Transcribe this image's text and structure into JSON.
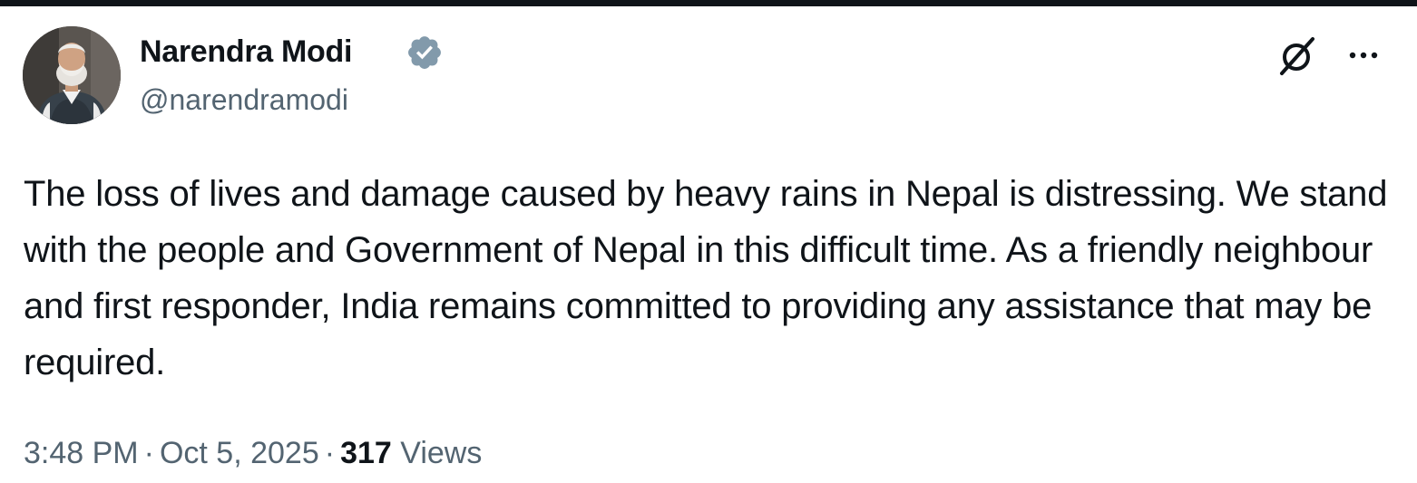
{
  "author": {
    "display_name": "Narendra Modi",
    "handle": "@narendramodi",
    "verified": true,
    "verified_badge_color": "#829aab"
  },
  "tweet": {
    "text": "The loss of lives and damage caused by heavy rains in Nepal is distressing. We stand with the people and Government of Nepal in this difficult time. As a friendly neighbour and first responder, India remains committed to providing any assistance that may be required.",
    "time": "3:48 PM",
    "separator": "·",
    "date": "Oct 5, 2025",
    "views_count": "317",
    "views_label": "Views"
  },
  "actions": {
    "grok_icon": "grok-icon",
    "more_icon": "more-icon"
  },
  "colors": {
    "text_primary": "#0f1419",
    "text_secondary": "#536471",
    "top_bar": "#0f1419"
  }
}
